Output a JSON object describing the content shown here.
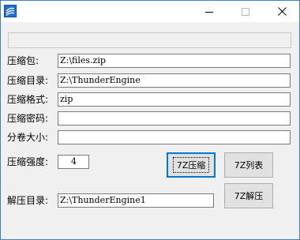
{
  "window": {
    "title": "",
    "controls": [
      "minimize-icon",
      "maximize-icon",
      "close-icon"
    ]
  },
  "form": {
    "fields": [
      {
        "label": "压缩包:",
        "value": "Z:\\files.zip"
      },
      {
        "label": "压缩目录:",
        "value": "Z:\\ThunderEngine"
      },
      {
        "label": "压缩格式:",
        "value": "zip"
      },
      {
        "label": "压缩密码:",
        "value": ""
      },
      {
        "label": "分卷大小:",
        "value": ""
      }
    ],
    "strength": {
      "label": "压缩强度:",
      "value": "4"
    },
    "extract": {
      "label": "解压目录:",
      "value": "Z:\\ThunderEngine1"
    }
  },
  "buttons": {
    "compress": "7Z压缩",
    "list": "7Z列表",
    "extract": "7Z解压"
  }
}
